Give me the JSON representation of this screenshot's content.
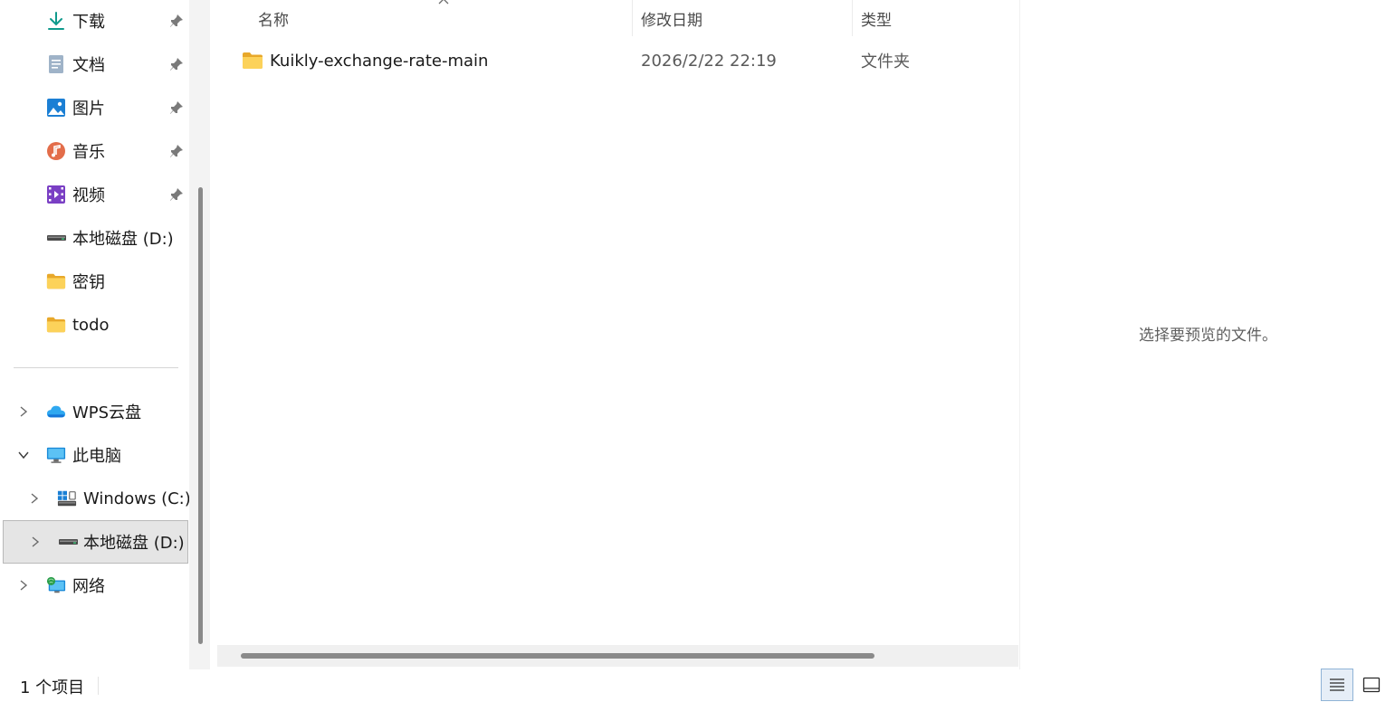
{
  "sidebar": {
    "quick_access": [
      {
        "label": "下载",
        "icon": "download-icon",
        "pinned": true
      },
      {
        "label": "文档",
        "icon": "document-icon",
        "pinned": true
      },
      {
        "label": "图片",
        "icon": "pictures-icon",
        "pinned": true
      },
      {
        "label": "音乐",
        "icon": "music-icon",
        "pinned": true
      },
      {
        "label": "视频",
        "icon": "video-icon",
        "pinned": true
      },
      {
        "label": "本地磁盘 (D:)",
        "icon": "drive-icon",
        "pinned": false
      },
      {
        "label": "密钥",
        "icon": "folder-icon",
        "pinned": false
      },
      {
        "label": "todo",
        "icon": "folder-icon",
        "pinned": false
      }
    ],
    "tree": [
      {
        "label": "WPS云盘",
        "icon": "cloud-icon",
        "expanded": false
      },
      {
        "label": "此电脑",
        "icon": "computer-icon",
        "expanded": true
      },
      {
        "label": "Windows (C:)",
        "icon": "windows-drive-icon",
        "expanded": false
      },
      {
        "label": "本地磁盘 (D:)",
        "icon": "drive-icon",
        "expanded": false,
        "selected": true
      },
      {
        "label": "网络",
        "icon": "network-icon",
        "expanded": false
      }
    ]
  },
  "list": {
    "columns": {
      "name": "名称",
      "date": "修改日期",
      "type": "类型"
    },
    "rows": [
      {
        "name": "Kuikly-exchange-rate-main",
        "date": "2026/2/22 22:19",
        "type": "文件夹",
        "icon": "folder-icon"
      }
    ]
  },
  "preview": {
    "message": "选择要预览的文件。"
  },
  "status": {
    "count": "1 个项目"
  },
  "colors": {
    "folder": "#f8c53a",
    "accent": "#0067c0",
    "selected_bg": "#e5e5e5"
  }
}
